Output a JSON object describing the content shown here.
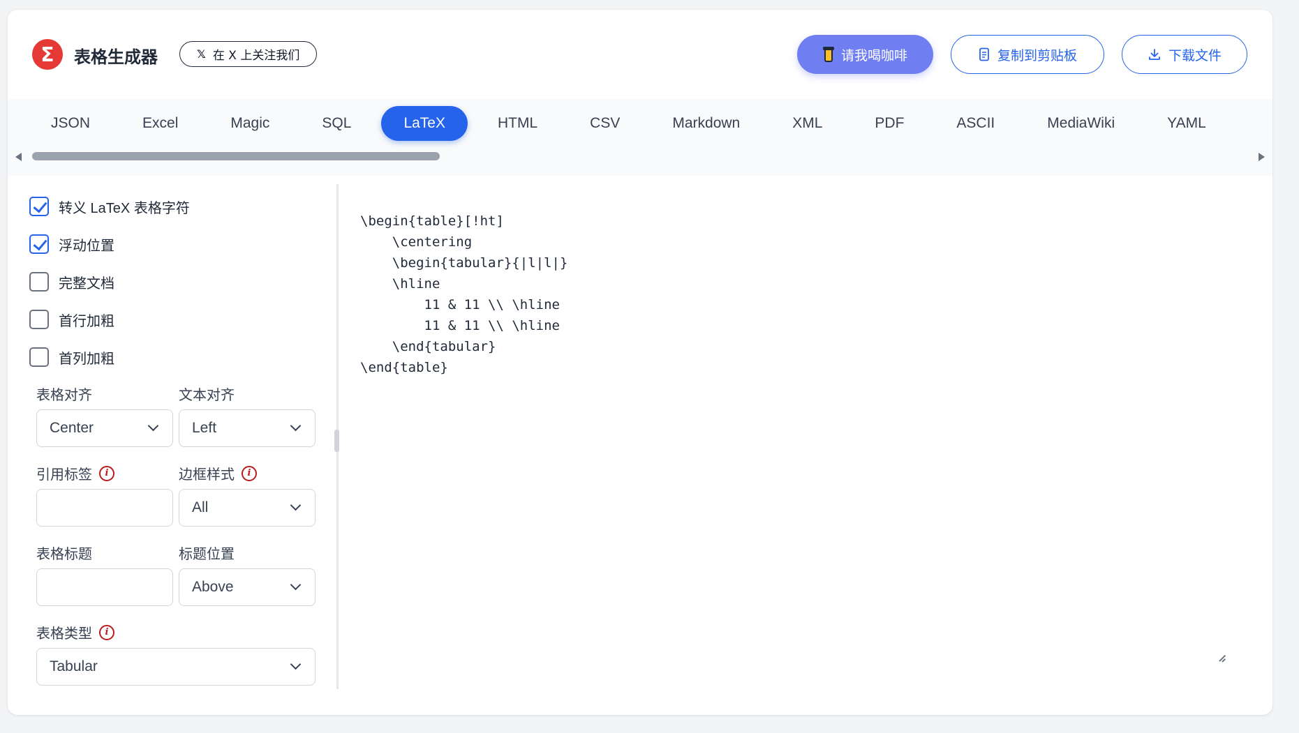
{
  "header": {
    "logo_glyph": "Σ",
    "app_title": "表格生成器",
    "follow_label": "在 X 上关注我们",
    "x_glyph": "𝕏",
    "coffee_label": "请我喝咖啡",
    "copy_label": "复制到剪贴板",
    "download_label": "下载文件",
    "accent_color": "#2563eb",
    "coffee_color": "#6f7ef0",
    "logo_color": "#e53935"
  },
  "tabs": [
    {
      "label": "JSON",
      "active": false
    },
    {
      "label": "Excel",
      "active": false
    },
    {
      "label": "Magic",
      "active": false
    },
    {
      "label": "SQL",
      "active": false
    },
    {
      "label": "LaTeX",
      "active": true
    },
    {
      "label": "HTML",
      "active": false
    },
    {
      "label": "CSV",
      "active": false
    },
    {
      "label": "Markdown",
      "active": false
    },
    {
      "label": "XML",
      "active": false
    },
    {
      "label": "PDF",
      "active": false
    },
    {
      "label": "ASCII",
      "active": false
    },
    {
      "label": "MediaWiki",
      "active": false
    },
    {
      "label": "YAML",
      "active": false
    }
  ],
  "options": {
    "checkboxes": [
      {
        "label": "转义 LaTeX 表格字符",
        "checked": true
      },
      {
        "label": "浮动位置",
        "checked": true
      },
      {
        "label": "完整文档",
        "checked": false
      },
      {
        "label": "首行加粗",
        "checked": false
      },
      {
        "label": "首列加粗",
        "checked": false
      }
    ],
    "table_align_label": "表格对齐",
    "table_align_value": "Center",
    "text_align_label": "文本对齐",
    "text_align_value": "Left",
    "ref_label": "引用标签",
    "ref_value": "",
    "border_label": "边框样式",
    "border_value": "All",
    "caption_label": "表格标题",
    "caption_value": "",
    "caption_pos_label": "标题位置",
    "caption_pos_value": "Above",
    "table_type_label": "表格类型",
    "table_type_value": "Tabular",
    "info_glyph": "i"
  },
  "output": {
    "code": "\\begin{table}[!ht]\n    \\centering\n    \\begin{tabular}{|l|l|}\n    \\hline\n        11 & 11 \\\\ \\hline\n        11 & 11 \\\\ \\hline\n    \\end{tabular}\n\\end{table}"
  }
}
